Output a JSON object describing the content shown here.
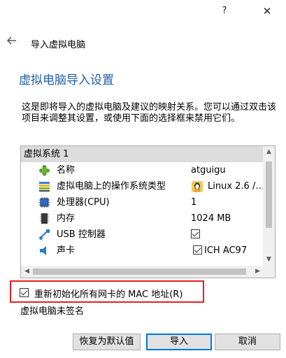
{
  "titlebar": {
    "help": "?",
    "close": "✕"
  },
  "header": {
    "title": "导入虚拟电脑"
  },
  "page": {
    "title": "虚拟电脑导入设置",
    "description": "这是即将导入的虚拟电脑及建议的映射关系。您可以通过双击该项目来调整其设置，或使用下面的选择框来禁用它们。"
  },
  "tree": {
    "header": "虚拟系统 1",
    "rows": [
      {
        "label": "名称",
        "value": "atguigu",
        "icon": "puzzle-icon"
      },
      {
        "label": "虚拟电脑上的操作系统类型",
        "value": "Linux 2.6 /…",
        "icon": "os-type-icon"
      },
      {
        "label": "处理器(CPU)",
        "value": "1",
        "icon": "cpu-icon"
      },
      {
        "label": "内存",
        "value": "1024 MB",
        "icon": "memory-icon"
      },
      {
        "label": "USB 控制器",
        "value": "",
        "checked": true,
        "icon": "usb-icon"
      },
      {
        "label": "声卡",
        "value": "ICH AC97",
        "checked": true,
        "icon": "sound-icon"
      }
    ]
  },
  "options": {
    "reinit_mac": "重新初始化所有网卡的 MAC 地址(R)",
    "reinit_mac_checked": true
  },
  "status": {
    "unsigned": "虚拟电脑未签名"
  },
  "buttons": {
    "restore": "恢复为默认值",
    "import": "导入",
    "cancel": "取消"
  },
  "colors": {
    "title_blue": "#1f5fa8",
    "highlight_red": "#e02020"
  }
}
